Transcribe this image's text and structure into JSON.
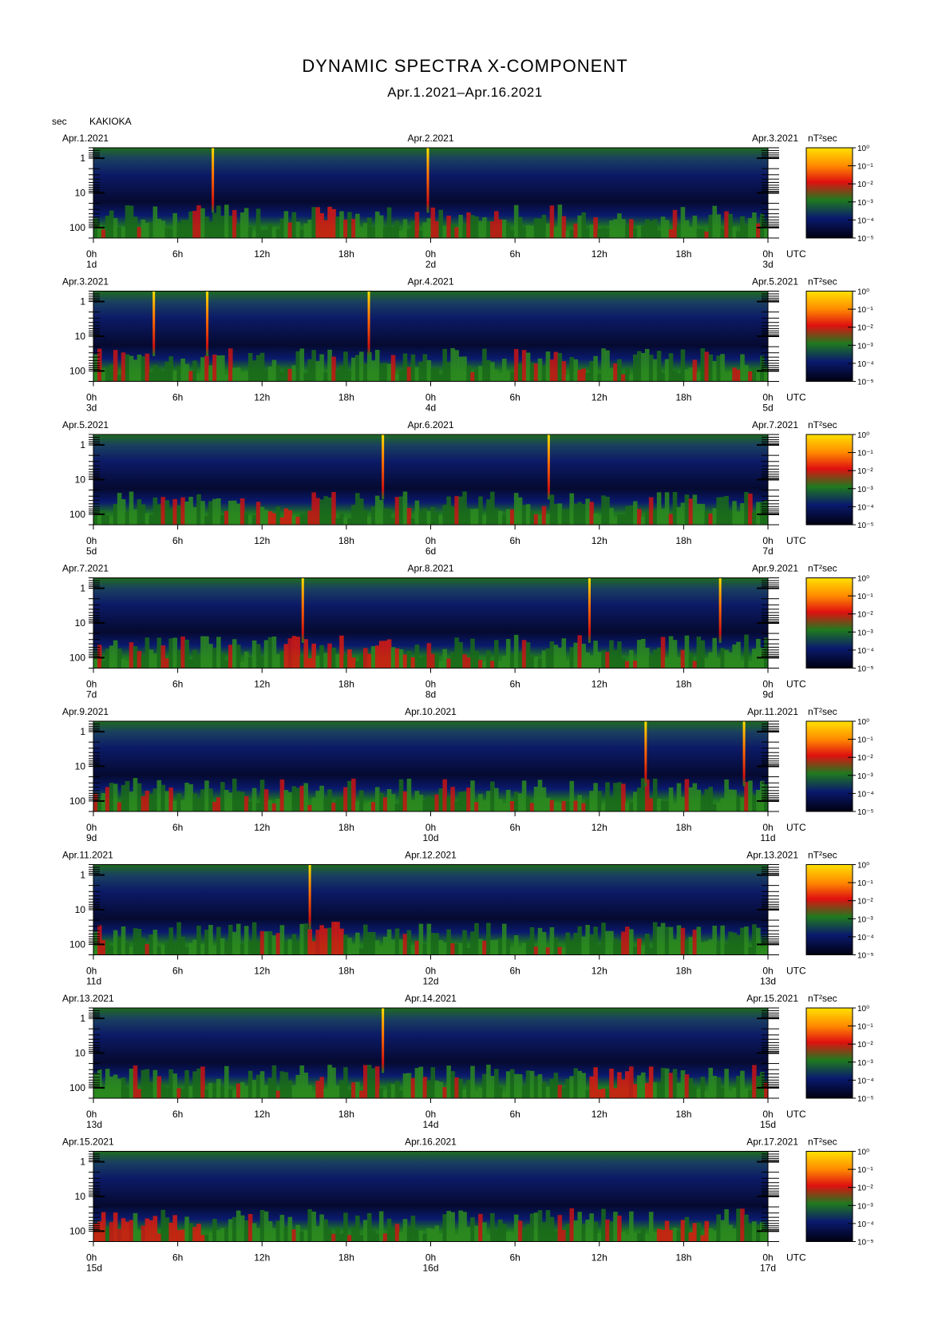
{
  "title": "DYNAMIC SPECTRA X-COMPONENT",
  "subtitle": "Apr.1.2021–Apr.16.2021",
  "yunit": "sec",
  "station": "KAKIOKA",
  "colorbar_unit": "nT²sec",
  "time_unit": "UTC",
  "colors": {
    "low": "#000010",
    "mid_low": "#0a1a6e",
    "mid": "#1f7a1f",
    "high": "#e01010",
    "peak": "#ffd700"
  },
  "chart_data": {
    "type": "heatmap",
    "description": "spectrogram, period (sec) vs time, power in nT^2 sec",
    "y_axis": {
      "label": "sec",
      "scale": "log",
      "ticks": [
        "1",
        "10",
        "100"
      ]
    },
    "x_ticks": [
      "0h",
      "6h",
      "12h",
      "18h",
      "0h",
      "6h",
      "12h",
      "18h",
      "0h"
    ],
    "colorbar": {
      "scale": "log",
      "ticks": [
        "10⁰",
        "10⁻¹",
        "10⁻²",
        "10⁻³",
        "10⁻⁴",
        "10⁻⁵"
      ]
    },
    "panels": [
      {
        "left_date": "Apr.1.2021",
        "mid_date": "Apr.2.2021",
        "right_date": "Apr.3.2021",
        "days": [
          "1d",
          "2d",
          "3d"
        ],
        "spikes_h": [
          8.5,
          23.8
        ],
        "active_h": [
          [
            15.5,
            17
          ]
        ]
      },
      {
        "left_date": "Apr.3.2021",
        "mid_date": "Apr.4.2021",
        "right_date": "Apr.5.2021",
        "days": [
          "3d",
          "4d",
          "5d"
        ],
        "spikes_h": [
          4.3,
          8.1,
          19.6
        ],
        "active_h": []
      },
      {
        "left_date": "Apr.5.2021",
        "mid_date": "Apr.6.2021",
        "right_date": "Apr.7.2021",
        "days": [
          "5d",
          "6d",
          "7d"
        ],
        "spikes_h": [
          20.6,
          32.4
        ],
        "active_h": [
          [
            12,
            15
          ]
        ]
      },
      {
        "left_date": "Apr.7.2021",
        "mid_date": "Apr.8.2021",
        "right_date": "Apr.9.2021",
        "days": [
          "7d",
          "8d",
          "9d"
        ],
        "spikes_h": [
          14.9,
          35.3,
          44.6
        ],
        "active_h": [
          [
            13.5,
            23
          ]
        ]
      },
      {
        "left_date": "Apr.9.2021",
        "mid_date": "Apr.10.2021",
        "right_date": "Apr.11.2021",
        "days": [
          "9d",
          "10d",
          "11d"
        ],
        "spikes_h": [
          39.3,
          46.3
        ],
        "active_h": []
      },
      {
        "left_date": "Apr.11.2021",
        "mid_date": "Apr.12.2021",
        "right_date": "Apr.13.2021",
        "days": [
          "11d",
          "12d",
          "13d"
        ],
        "spikes_h": [
          15.4
        ],
        "active_h": [
          [
            15,
            18
          ]
        ]
      },
      {
        "left_date": "Apr.13.2021",
        "mid_date": "Apr.14.2021",
        "right_date": "Apr.15.2021",
        "days": [
          "13d",
          "14d",
          "15d"
        ],
        "spikes_h": [
          20.6
        ],
        "active_h": [
          [
            35,
            40
          ]
        ]
      },
      {
        "left_date": "Apr.15.2021",
        "mid_date": "Apr.16.2021",
        "right_date": "Apr.17.2021",
        "days": [
          "15d",
          "16d",
          "17d"
        ],
        "spikes_h": [],
        "active_h": [
          [
            0,
            8
          ],
          [
            40,
            44
          ]
        ]
      }
    ]
  }
}
